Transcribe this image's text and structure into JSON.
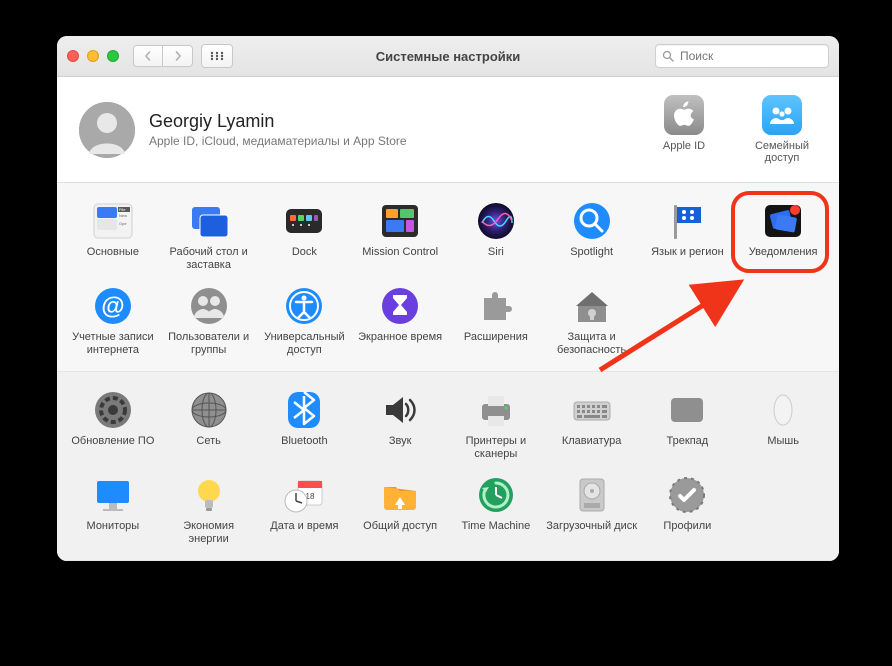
{
  "window": {
    "title": "Системные настройки",
    "search_placeholder": "Поиск"
  },
  "user": {
    "name": "Georgiy Lyamin",
    "subtitle": "Apple ID, iCloud, медиаматериалы и App Store"
  },
  "header_panes": [
    {
      "id": "apple-id",
      "label": "Apple ID"
    },
    {
      "id": "family-sharing",
      "label": "Семейный доступ"
    }
  ],
  "rows": [
    {
      "items": [
        {
          "id": "general",
          "label": "Основные"
        },
        {
          "id": "desktop",
          "label": "Рабочий стол и заставка"
        },
        {
          "id": "dock",
          "label": "Dock"
        },
        {
          "id": "mission-control",
          "label": "Mission Control"
        },
        {
          "id": "siri",
          "label": "Siri"
        },
        {
          "id": "spotlight",
          "label": "Spotlight"
        },
        {
          "id": "language-region",
          "label": "Язык и регион"
        },
        {
          "id": "notifications",
          "label": "Уведомления"
        }
      ]
    },
    {
      "items": [
        {
          "id": "internet-accounts",
          "label": "Учетные записи интернета"
        },
        {
          "id": "users-groups",
          "label": "Пользователи и группы"
        },
        {
          "id": "accessibility",
          "label": "Универсальный доступ"
        },
        {
          "id": "screen-time",
          "label": "Экранное время"
        },
        {
          "id": "extensions",
          "label": "Расширения"
        },
        {
          "id": "security",
          "label": "Защита и безопасность"
        }
      ]
    },
    {
      "items": [
        {
          "id": "software-update",
          "label": "Обновление ПО"
        },
        {
          "id": "network",
          "label": "Сеть"
        },
        {
          "id": "bluetooth",
          "label": "Bluetooth"
        },
        {
          "id": "sound",
          "label": "Звук"
        },
        {
          "id": "printers",
          "label": "Принтеры и сканеры"
        },
        {
          "id": "keyboard",
          "label": "Клавиатура"
        },
        {
          "id": "trackpad",
          "label": "Трекпад"
        },
        {
          "id": "mouse",
          "label": "Мышь"
        }
      ]
    },
    {
      "items": [
        {
          "id": "displays",
          "label": "Мониторы"
        },
        {
          "id": "energy",
          "label": "Экономия энергии"
        },
        {
          "id": "date-time",
          "label": "Дата и время"
        },
        {
          "id": "sharing",
          "label": "Общий доступ"
        },
        {
          "id": "time-machine",
          "label": "Time Machine"
        },
        {
          "id": "startup-disk",
          "label": "Загрузочный диск"
        },
        {
          "id": "profiles",
          "label": "Профили"
        }
      ]
    }
  ],
  "annotations": {
    "highlight_target": "notifications"
  }
}
